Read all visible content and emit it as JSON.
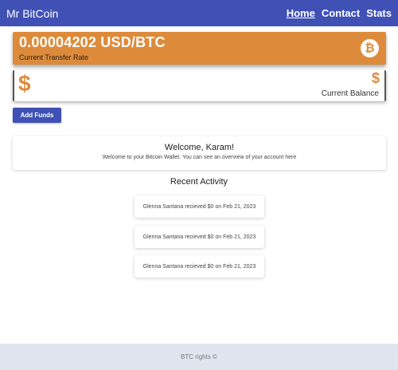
{
  "navbar": {
    "brand": "Mr BitCoin",
    "links": [
      {
        "label": "Home",
        "active": true
      },
      {
        "label": "Contact",
        "active": false
      },
      {
        "label": "Stats",
        "active": false
      }
    ]
  },
  "rate_card": {
    "value": "0.00004202 USD/BTC",
    "label": "Current Transfer Rate",
    "icon": "bitcoin-icon",
    "icon_glyph": "₿",
    "color": "#dd8b3b"
  },
  "balance_card": {
    "icon": "dollar-icon",
    "icon_glyph": "$",
    "small_glyph": "$",
    "label": "Current Balance"
  },
  "add_funds_label": "Add Funds",
  "welcome": {
    "title": "Welcome, Karam!",
    "subtitle": "Welcome to your Bitcoin Wallet. You can see an overview of your account here"
  },
  "recent_activity": {
    "title": "Recent Activity",
    "items": [
      "Glenna Santana recieved $0 on Feb 21, 2023",
      "Glenna Santana recieved $0 on Feb 21, 2023",
      "Glenna Santana recieved $0 on Feb 21, 2023"
    ]
  },
  "footer": {
    "text": "BTC rights ©"
  },
  "colors": {
    "primary": "#3f51b5",
    "accent": "#dd8b3b",
    "footer_bg": "#e0e5ef"
  }
}
